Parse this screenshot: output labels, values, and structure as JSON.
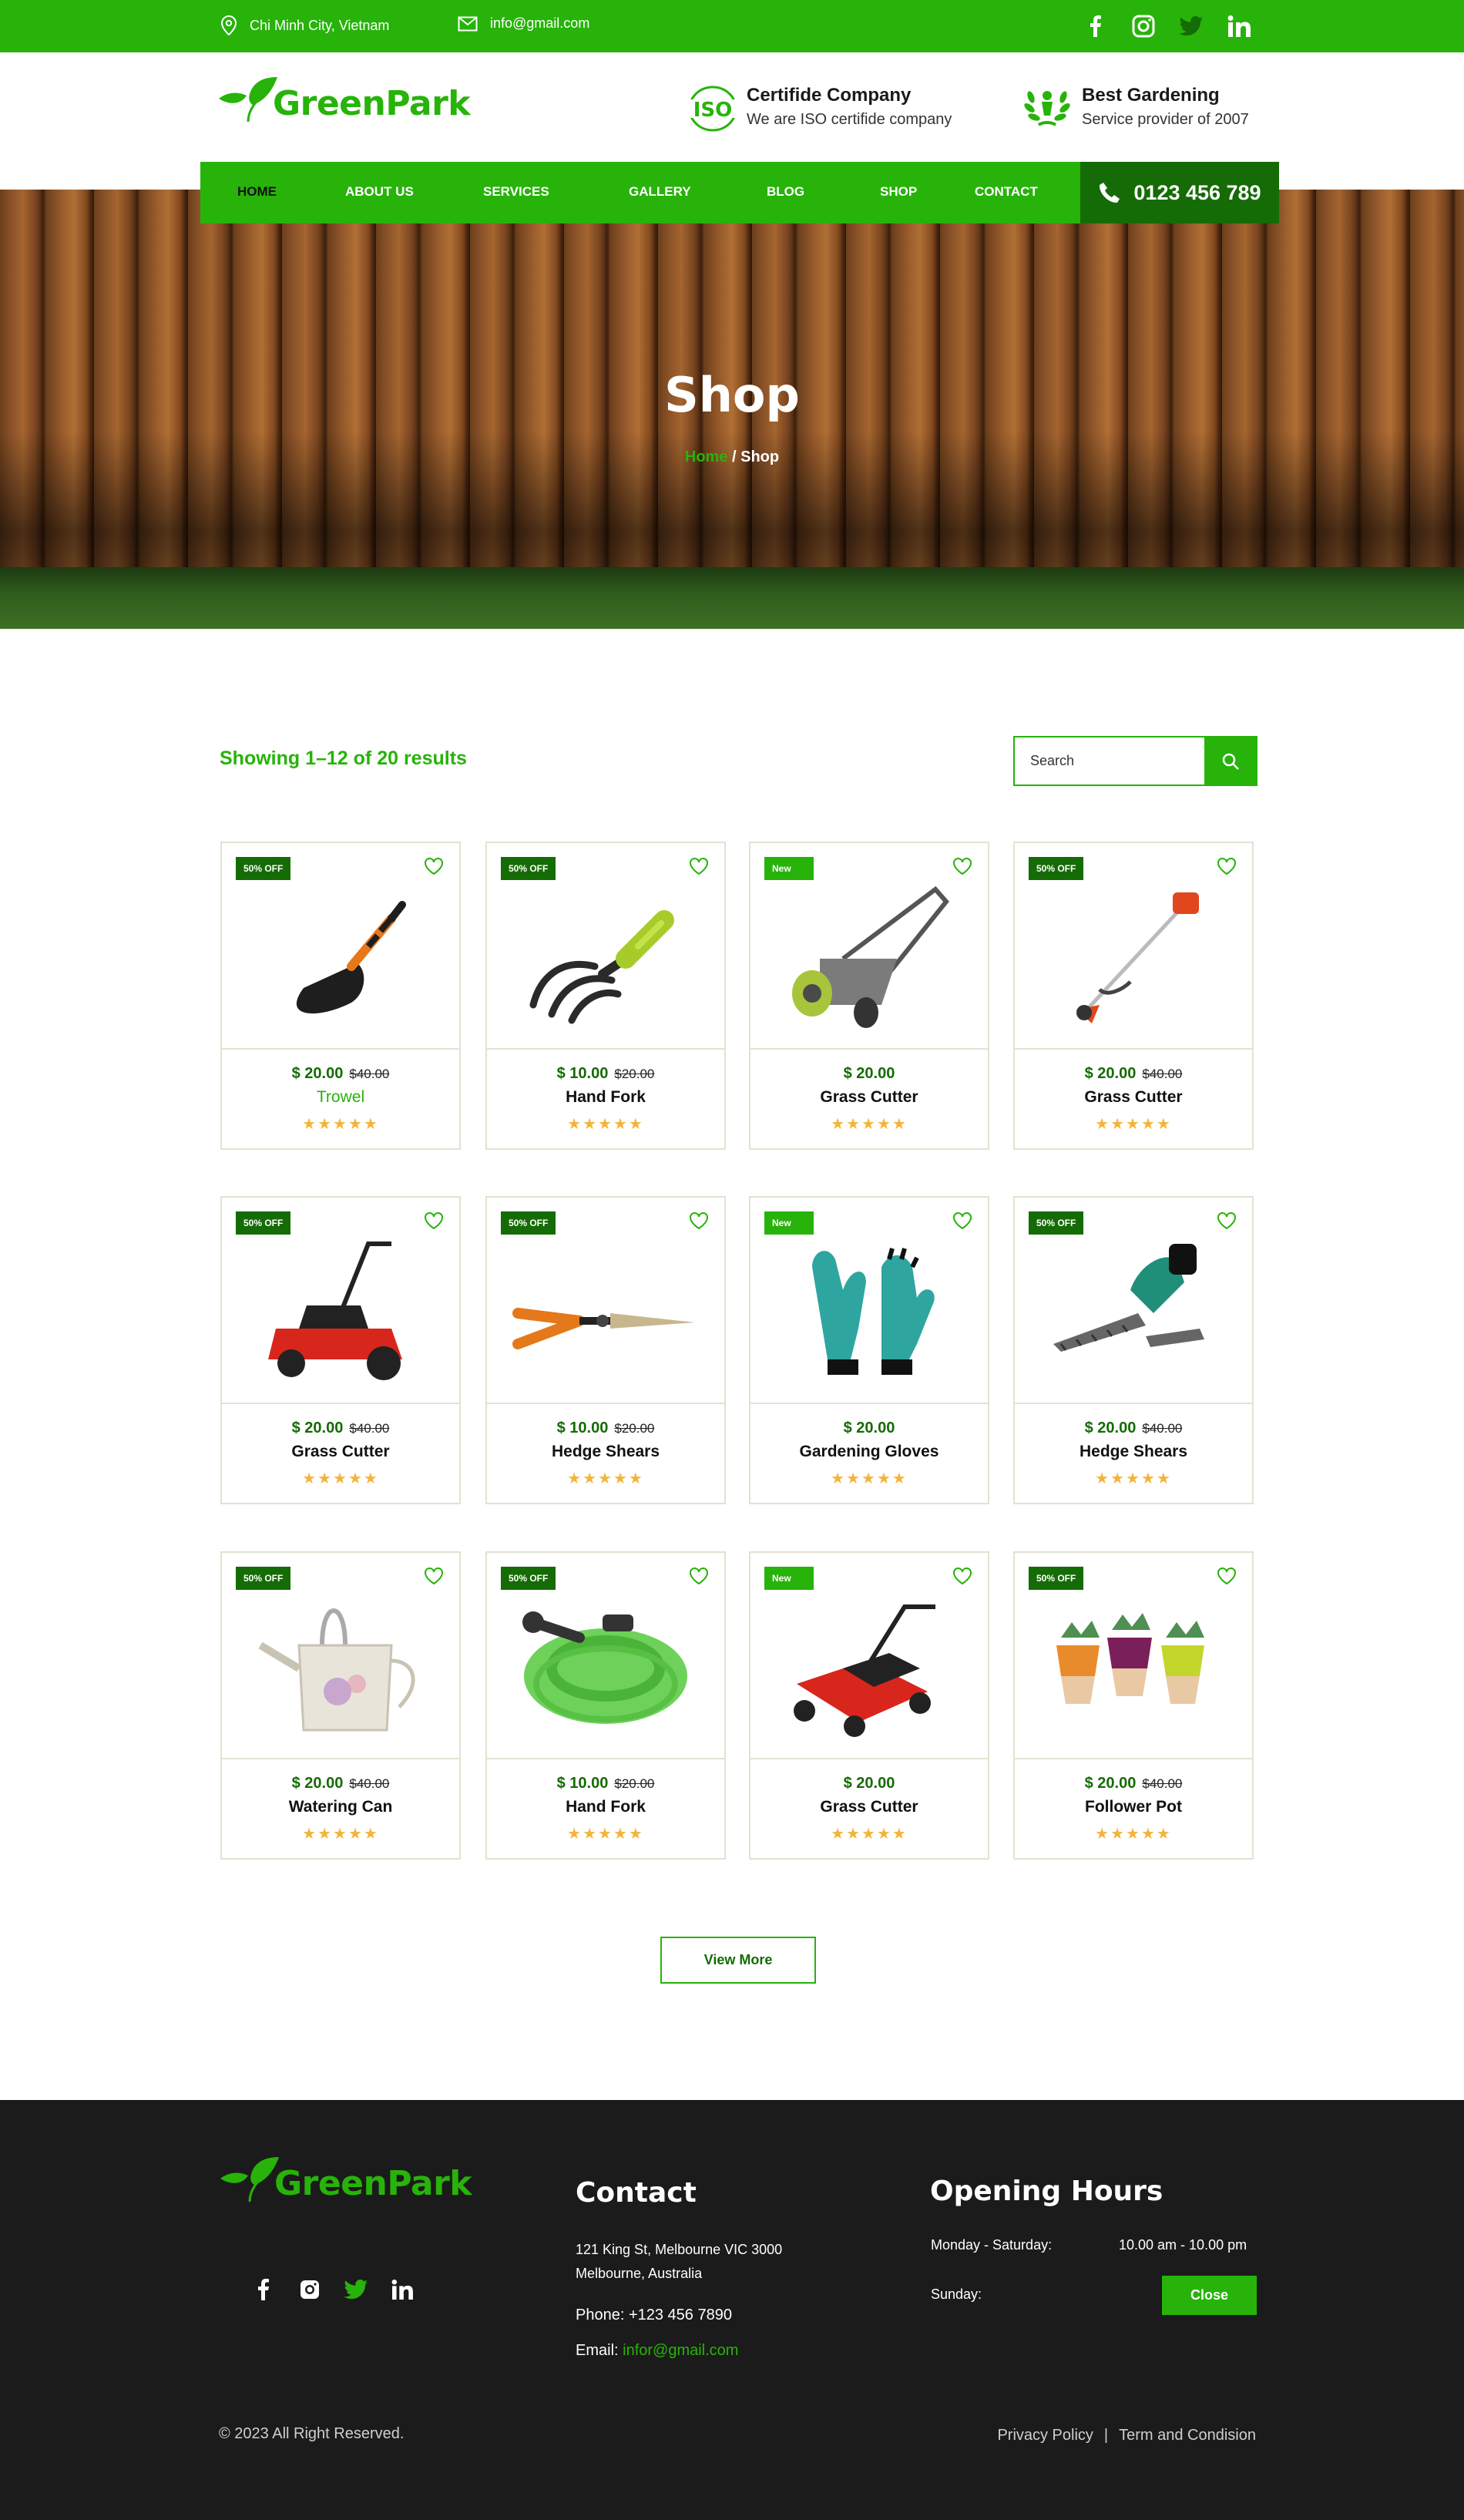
{
  "colors": {
    "brand_green": "#27b30a",
    "dark_green": "#156b05",
    "star": "#f4b43a",
    "footer_bg": "#1b1b1b"
  },
  "topbar": {
    "location": "Chi Minh City, Vietnam",
    "email": "info@gmail.com",
    "social": [
      "facebook-icon",
      "instagram-icon",
      "twitter-icon",
      "linkedin-icon"
    ]
  },
  "header": {
    "logo_text": "GreenPark",
    "badge1": {
      "icon": "iso-icon",
      "icon_text": "ISO",
      "title": "Certifide Company",
      "subtitle": "We are ISO certifide company"
    },
    "badge2": {
      "icon": "laurel-icon",
      "title": "Best Gardening",
      "subtitle": "Service provider of 2007"
    }
  },
  "nav": {
    "items": [
      "HOME",
      "ABOUT US",
      "SERVICES",
      "GALLERY",
      "BLOG",
      "SHOP",
      "CONTACT"
    ],
    "active": "HOME",
    "phone": "0123 456 789"
  },
  "hero": {
    "title": "Shop",
    "crumb_home": "Home",
    "crumb_sep": " / ",
    "crumb_current": "Shop"
  },
  "shop": {
    "results_text": "Showing 1–12 of  20 results",
    "search_placeholder": "Search",
    "stars": "★★★★★",
    "products": [
      {
        "badge": "50% OFF",
        "price": "$ 20.00",
        "old_price": "$40.00",
        "name": "Trowel",
        "image": "trowel"
      },
      {
        "badge": "50% OFF",
        "price": "$ 10.00",
        "old_price": "$20.00",
        "name": "Hand Fork",
        "image": "hand-fork"
      },
      {
        "badge": "New",
        "price": "$ 20.00",
        "old_price": "",
        "name": "Grass Cutter",
        "image": "reel-mower"
      },
      {
        "badge": "50% OFF",
        "price": "$ 20.00",
        "old_price": "$40.00",
        "name": "Grass Cutter",
        "image": "string-trimmer"
      },
      {
        "badge": "50% OFF",
        "price": "$ 20.00",
        "old_price": "$40.00",
        "name": "Grass Cutter",
        "image": "petrol-mower"
      },
      {
        "badge": "50% OFF",
        "price": "$ 10.00",
        "old_price": "$20.00",
        "name": "Hedge Shears",
        "image": "hedge-shears"
      },
      {
        "badge": "New",
        "price": "$ 20.00",
        "old_price": "",
        "name": "Gardening Gloves",
        "image": "gloves"
      },
      {
        "badge": "50% OFF",
        "price": "$ 20.00",
        "old_price": "$40.00",
        "name": "Hedge Shears",
        "image": "cordless-shears"
      },
      {
        "badge": "50% OFF",
        "price": "$ 20.00",
        "old_price": "$40.00",
        "name": "Watering Can",
        "image": "watering-can"
      },
      {
        "badge": "50% OFF",
        "price": "$ 10.00",
        "old_price": "$20.00",
        "name": "Hand Fork",
        "image": "garden-hose"
      },
      {
        "badge": "New",
        "price": "$ 20.00",
        "old_price": "",
        "name": "Grass Cutter",
        "image": "electric-mower"
      },
      {
        "badge": "50% OFF",
        "price": "$ 20.00",
        "old_price": "$40.00",
        "name": "Follower Pot",
        "image": "flower-pots"
      }
    ],
    "view_more": "View More"
  },
  "footer": {
    "logo_text": "GreenPark",
    "social": [
      "facebook-icon",
      "instagram-icon",
      "twitter-icon",
      "linkedin-icon"
    ],
    "contact": {
      "title": "Contact",
      "address1": "121 King St, Melbourne VIC 3000",
      "address2": "Melbourne, Australia",
      "phone": "Phone: +123 456 7890",
      "email_label": "Email: ",
      "email": "infor@gmail.com"
    },
    "hours": {
      "title": "Opening Hours",
      "row1_label": "Monday - Saturday:",
      "row1_value": "10.00 am - 10.00 pm",
      "row2_label": "Sunday:",
      "row2_value": "Close"
    },
    "copyright": "© 2023 All Right Reserved.",
    "privacy": "Privacy Policy",
    "separator": "|",
    "terms": "Term and Condision"
  }
}
